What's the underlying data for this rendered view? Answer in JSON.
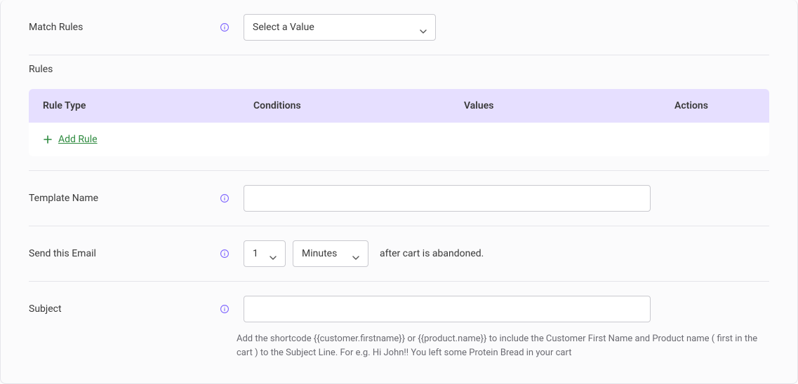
{
  "match_rules": {
    "label": "Match Rules",
    "select_value": "Select a Value"
  },
  "rules_section": {
    "heading": "Rules",
    "columns": {
      "type": "Rule Type",
      "conditions": "Conditions",
      "values": "Values",
      "actions": "Actions"
    },
    "add_rule_label": "Add Rule"
  },
  "template_name": {
    "label": "Template Name",
    "value": ""
  },
  "send_email": {
    "label": "Send this Email",
    "number": "1",
    "unit": "Minutes",
    "after_text": "after cart is abandoned."
  },
  "subject": {
    "label": "Subject",
    "value": "",
    "help_text": "Add the shortcode {{customer.firstname}} or {{product.name}} to include the Customer First Name and Product name ( first in the cart ) to the Subject Line. For e.g. Hi John!! You left some Protein Bread in your cart"
  },
  "colors": {
    "header_bg": "#e6dfff",
    "accent": "#7b61ff",
    "add_green": "#2d8a3e"
  }
}
